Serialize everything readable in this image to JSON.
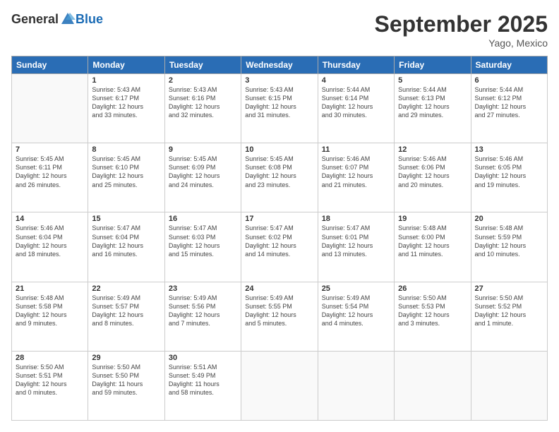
{
  "header": {
    "logo_general": "General",
    "logo_blue": "Blue",
    "month": "September 2025",
    "location": "Yago, Mexico"
  },
  "weekdays": [
    "Sunday",
    "Monday",
    "Tuesday",
    "Wednesday",
    "Thursday",
    "Friday",
    "Saturday"
  ],
  "weeks": [
    [
      {
        "day": "",
        "info": ""
      },
      {
        "day": "1",
        "info": "Sunrise: 5:43 AM\nSunset: 6:17 PM\nDaylight: 12 hours\nand 33 minutes."
      },
      {
        "day": "2",
        "info": "Sunrise: 5:43 AM\nSunset: 6:16 PM\nDaylight: 12 hours\nand 32 minutes."
      },
      {
        "day": "3",
        "info": "Sunrise: 5:43 AM\nSunset: 6:15 PM\nDaylight: 12 hours\nand 31 minutes."
      },
      {
        "day": "4",
        "info": "Sunrise: 5:44 AM\nSunset: 6:14 PM\nDaylight: 12 hours\nand 30 minutes."
      },
      {
        "day": "5",
        "info": "Sunrise: 5:44 AM\nSunset: 6:13 PM\nDaylight: 12 hours\nand 29 minutes."
      },
      {
        "day": "6",
        "info": "Sunrise: 5:44 AM\nSunset: 6:12 PM\nDaylight: 12 hours\nand 27 minutes."
      }
    ],
    [
      {
        "day": "7",
        "info": "Sunrise: 5:45 AM\nSunset: 6:11 PM\nDaylight: 12 hours\nand 26 minutes."
      },
      {
        "day": "8",
        "info": "Sunrise: 5:45 AM\nSunset: 6:10 PM\nDaylight: 12 hours\nand 25 minutes."
      },
      {
        "day": "9",
        "info": "Sunrise: 5:45 AM\nSunset: 6:09 PM\nDaylight: 12 hours\nand 24 minutes."
      },
      {
        "day": "10",
        "info": "Sunrise: 5:45 AM\nSunset: 6:08 PM\nDaylight: 12 hours\nand 23 minutes."
      },
      {
        "day": "11",
        "info": "Sunrise: 5:46 AM\nSunset: 6:07 PM\nDaylight: 12 hours\nand 21 minutes."
      },
      {
        "day": "12",
        "info": "Sunrise: 5:46 AM\nSunset: 6:06 PM\nDaylight: 12 hours\nand 20 minutes."
      },
      {
        "day": "13",
        "info": "Sunrise: 5:46 AM\nSunset: 6:05 PM\nDaylight: 12 hours\nand 19 minutes."
      }
    ],
    [
      {
        "day": "14",
        "info": "Sunrise: 5:46 AM\nSunset: 6:04 PM\nDaylight: 12 hours\nand 18 minutes."
      },
      {
        "day": "15",
        "info": "Sunrise: 5:47 AM\nSunset: 6:04 PM\nDaylight: 12 hours\nand 16 minutes."
      },
      {
        "day": "16",
        "info": "Sunrise: 5:47 AM\nSunset: 6:03 PM\nDaylight: 12 hours\nand 15 minutes."
      },
      {
        "day": "17",
        "info": "Sunrise: 5:47 AM\nSunset: 6:02 PM\nDaylight: 12 hours\nand 14 minutes."
      },
      {
        "day": "18",
        "info": "Sunrise: 5:47 AM\nSunset: 6:01 PM\nDaylight: 12 hours\nand 13 minutes."
      },
      {
        "day": "19",
        "info": "Sunrise: 5:48 AM\nSunset: 6:00 PM\nDaylight: 12 hours\nand 11 minutes."
      },
      {
        "day": "20",
        "info": "Sunrise: 5:48 AM\nSunset: 5:59 PM\nDaylight: 12 hours\nand 10 minutes."
      }
    ],
    [
      {
        "day": "21",
        "info": "Sunrise: 5:48 AM\nSunset: 5:58 PM\nDaylight: 12 hours\nand 9 minutes."
      },
      {
        "day": "22",
        "info": "Sunrise: 5:49 AM\nSunset: 5:57 PM\nDaylight: 12 hours\nand 8 minutes."
      },
      {
        "day": "23",
        "info": "Sunrise: 5:49 AM\nSunset: 5:56 PM\nDaylight: 12 hours\nand 7 minutes."
      },
      {
        "day": "24",
        "info": "Sunrise: 5:49 AM\nSunset: 5:55 PM\nDaylight: 12 hours\nand 5 minutes."
      },
      {
        "day": "25",
        "info": "Sunrise: 5:49 AM\nSunset: 5:54 PM\nDaylight: 12 hours\nand 4 minutes."
      },
      {
        "day": "26",
        "info": "Sunrise: 5:50 AM\nSunset: 5:53 PM\nDaylight: 12 hours\nand 3 minutes."
      },
      {
        "day": "27",
        "info": "Sunrise: 5:50 AM\nSunset: 5:52 PM\nDaylight: 12 hours\nand 1 minute."
      }
    ],
    [
      {
        "day": "28",
        "info": "Sunrise: 5:50 AM\nSunset: 5:51 PM\nDaylight: 12 hours\nand 0 minutes."
      },
      {
        "day": "29",
        "info": "Sunrise: 5:50 AM\nSunset: 5:50 PM\nDaylight: 11 hours\nand 59 minutes."
      },
      {
        "day": "30",
        "info": "Sunrise: 5:51 AM\nSunset: 5:49 PM\nDaylight: 11 hours\nand 58 minutes."
      },
      {
        "day": "",
        "info": ""
      },
      {
        "day": "",
        "info": ""
      },
      {
        "day": "",
        "info": ""
      },
      {
        "day": "",
        "info": ""
      }
    ]
  ]
}
